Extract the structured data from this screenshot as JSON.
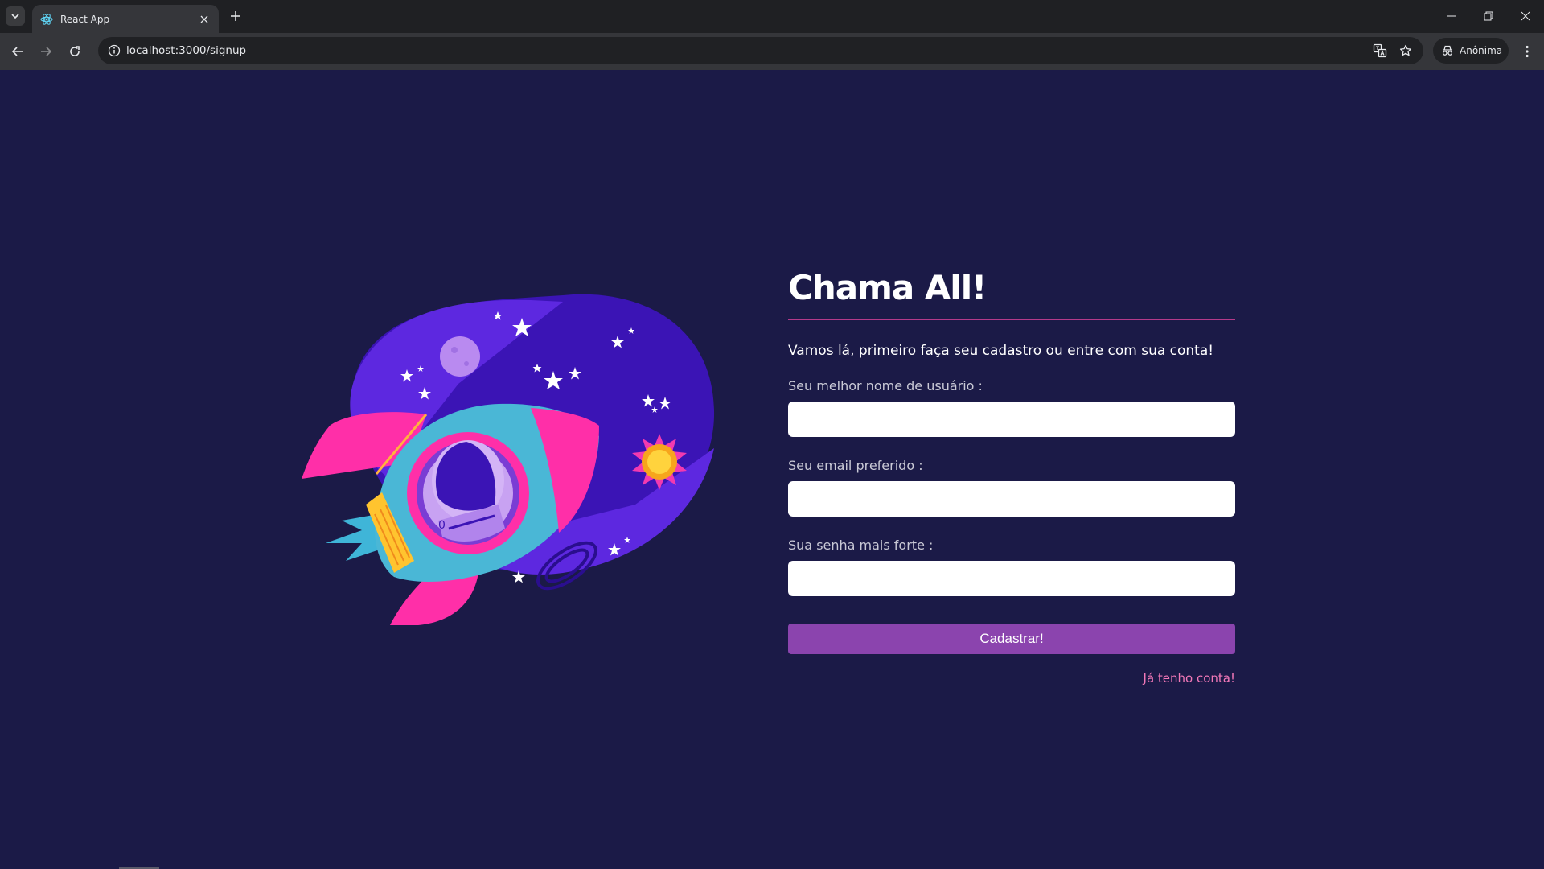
{
  "browser": {
    "tab_title": "React App",
    "url": "localhost:3000/signup",
    "profile_label": "Anônima",
    "icons": {
      "tab_search": "chevron-down-icon",
      "favicon": "react-icon",
      "tab_close": "close-icon",
      "new_tab": "plus-icon",
      "back": "arrow-left-icon",
      "forward": "arrow-right-icon",
      "reload": "reload-icon",
      "site_info": "info-icon",
      "translate": "translate-icon",
      "bookmark": "star-icon",
      "incognito": "incognito-icon",
      "menu": "more-vertical-icon",
      "minimize": "minimize-icon",
      "restore": "restore-icon",
      "close_window": "close-icon"
    }
  },
  "signup": {
    "title": "Chama All!",
    "subtitle": "Vamos lá, primeiro faça seu cadastro ou entre com sua conta!",
    "username_label": "Seu melhor nome de usuário :",
    "username_value": "",
    "email_label": "Seu email preferido :",
    "email_value": "",
    "password_label": "Sua senha mais forte :",
    "password_value": "",
    "submit_label": "Cadastrar!",
    "login_link": "Já tenho conta!"
  },
  "colors": {
    "page_background": "#1b1a47",
    "accent_button": "#8b44ae",
    "divider": "#b43a8a",
    "link": "#f278b8"
  }
}
